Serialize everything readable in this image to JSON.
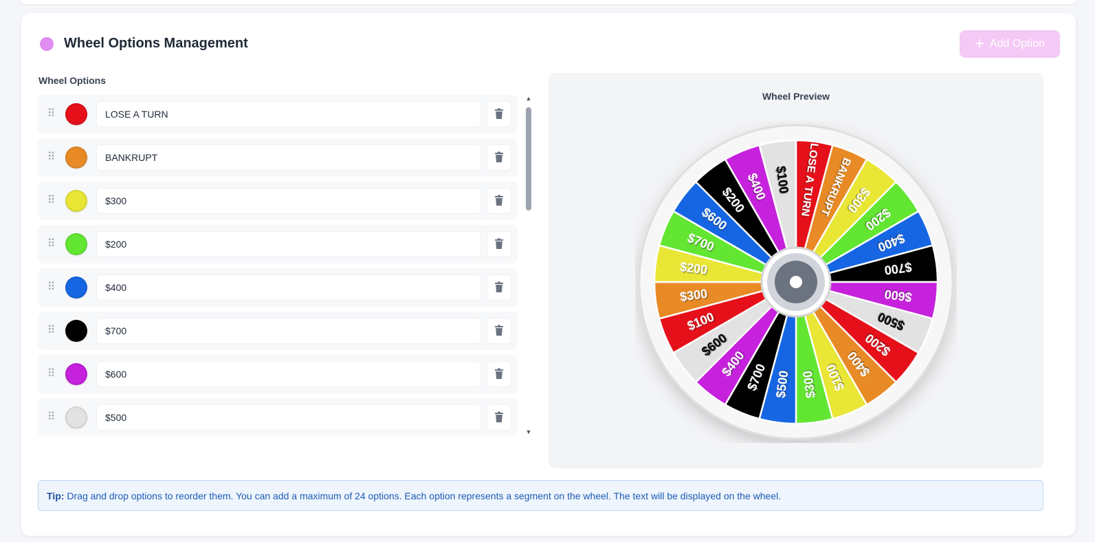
{
  "header": {
    "title": "Wheel Options Management",
    "accent_color": "#e08cf0",
    "add_button_label": "Add Option",
    "add_button_icon": "plus-icon"
  },
  "list": {
    "label": "Wheel Options",
    "options": [
      {
        "text": "LOSE A TURN",
        "color": "#e51019"
      },
      {
        "text": "BANKRUPT",
        "color": "#e88a25"
      },
      {
        "text": "$300",
        "color": "#e9e636"
      },
      {
        "text": "$200",
        "color": "#63e632"
      },
      {
        "text": "$400",
        "color": "#1666e4"
      },
      {
        "text": "$700",
        "color": "#000000"
      },
      {
        "text": "$600",
        "color": "#c622dd"
      },
      {
        "text": "$500",
        "color": "#e2e2e2"
      }
    ]
  },
  "preview": {
    "title": "Wheel Preview",
    "segments": [
      {
        "text": "LOSE A TURN",
        "color": "#e51019",
        "text_color": "#ffffff"
      },
      {
        "text": "BANKRUPT",
        "color": "#e88a25",
        "text_color": "#ffffff"
      },
      {
        "text": "$300",
        "color": "#e9e636",
        "text_color": "#ffffff"
      },
      {
        "text": "$200",
        "color": "#63e632",
        "text_color": "#ffffff"
      },
      {
        "text": "$400",
        "color": "#1666e4",
        "text_color": "#ffffff"
      },
      {
        "text": "$700",
        "color": "#000000",
        "text_color": "#ffffff"
      },
      {
        "text": "$600",
        "color": "#c622dd",
        "text_color": "#ffffff"
      },
      {
        "text": "$500",
        "color": "#e2e2e2",
        "text_color": "#000000"
      },
      {
        "text": "$200",
        "color": "#e51019",
        "text_color": "#ffffff"
      },
      {
        "text": "$400",
        "color": "#e88a25",
        "text_color": "#ffffff"
      },
      {
        "text": "$100",
        "color": "#e9e636",
        "text_color": "#ffffff"
      },
      {
        "text": "$300",
        "color": "#63e632",
        "text_color": "#ffffff"
      },
      {
        "text": "$500",
        "color": "#1666e4",
        "text_color": "#ffffff"
      },
      {
        "text": "$700",
        "color": "#000000",
        "text_color": "#ffffff"
      },
      {
        "text": "$400",
        "color": "#c622dd",
        "text_color": "#ffffff"
      },
      {
        "text": "$600",
        "color": "#e2e2e2",
        "text_color": "#000000"
      },
      {
        "text": "$100",
        "color": "#e51019",
        "text_color": "#ffffff"
      },
      {
        "text": "$300",
        "color": "#e88a25",
        "text_color": "#ffffff"
      },
      {
        "text": "$200",
        "color": "#e9e636",
        "text_color": "#ffffff"
      },
      {
        "text": "$700",
        "color": "#63e632",
        "text_color": "#ffffff"
      },
      {
        "text": "$600",
        "color": "#1666e4",
        "text_color": "#ffffff"
      },
      {
        "text": "$200",
        "color": "#000000",
        "text_color": "#ffffff"
      },
      {
        "text": "$400",
        "color": "#c622dd",
        "text_color": "#ffffff"
      },
      {
        "text": "$100",
        "color": "#e2e2e2",
        "text_color": "#000000"
      }
    ]
  },
  "tip": {
    "label": "Tip:",
    "text": "Drag and drop options to reorder them. You can add a maximum of 24 options. Each option represents a segment on the wheel. The text will be displayed on the wheel."
  }
}
